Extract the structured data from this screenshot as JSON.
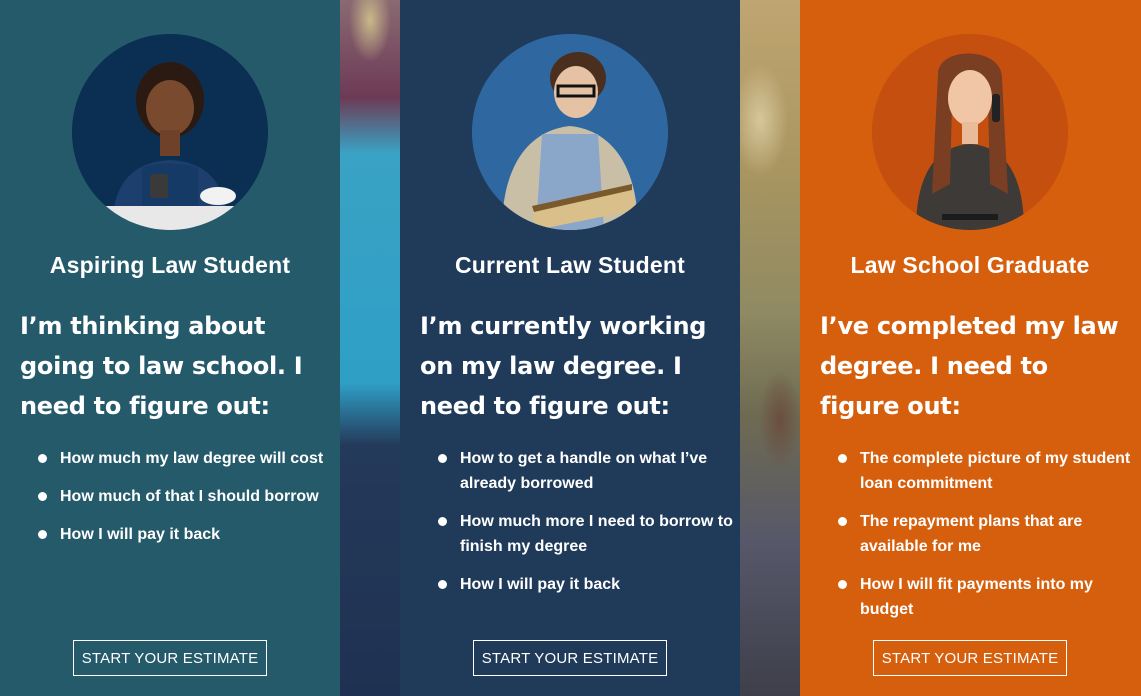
{
  "cards": [
    {
      "title": "Aspiring Law Student",
      "description": "I’m thinking about going to law school. I need to figure out:",
      "needs": [
        "How much my law degree will cost",
        "How much of that I should borrow",
        "How I will pay it back"
      ],
      "cta_label": "START YOUR ESTIMATE",
      "color": "#255a6b",
      "avatar_circle_color": "#0b2f52"
    },
    {
      "title": "Current Law Student",
      "description": "I’m currently working on my law degree. I need to figure out:",
      "needs": [
        "How to get a handle on what I’ve already borrowed",
        "How much more I need to borrow to finish my degree",
        "How I will pay it back"
      ],
      "cta_label": "START YOUR ESTIMATE",
      "color": "#203b5a",
      "avatar_circle_color": "#2f67a0"
    },
    {
      "title": "Law School Graduate",
      "description": "I’ve completed my law degree. I need to figure out:",
      "needs": [
        "The complete picture of my student loan commitment",
        "The repayment plans that are available for me",
        "How I will fit payments into my budget"
      ],
      "cta_label": "START YOUR ESTIMATE",
      "color": "#d65f0d",
      "avatar_circle_color": "#c54f0f"
    }
  ]
}
